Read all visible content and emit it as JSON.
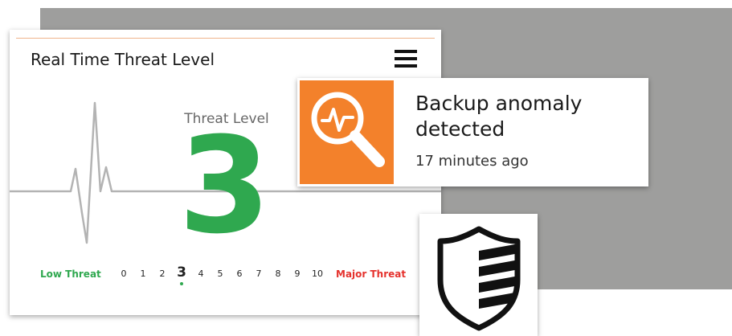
{
  "threat_widget": {
    "title": "Real Time Threat Level",
    "menu_icon": "hamburger-menu-icon",
    "level_label": "Threat Level",
    "level_value": "3",
    "level_color": "#2fa84f",
    "scale": {
      "low_label": "Low Threat",
      "major_label": "Major Threat",
      "ticks": [
        "0",
        "1",
        "2",
        "3",
        "4",
        "5",
        "6",
        "7",
        "8",
        "9",
        "10"
      ],
      "active_tick": "3",
      "low_color": "#2fa84f",
      "major_color": "#e5322d"
    }
  },
  "notification": {
    "icon": "anomaly-search-icon",
    "icon_bg_color": "#f3812b",
    "headline": "Backup anomaly detected",
    "time": "17 minutes ago"
  },
  "shield_badge": {
    "icon": "shield-icon"
  }
}
